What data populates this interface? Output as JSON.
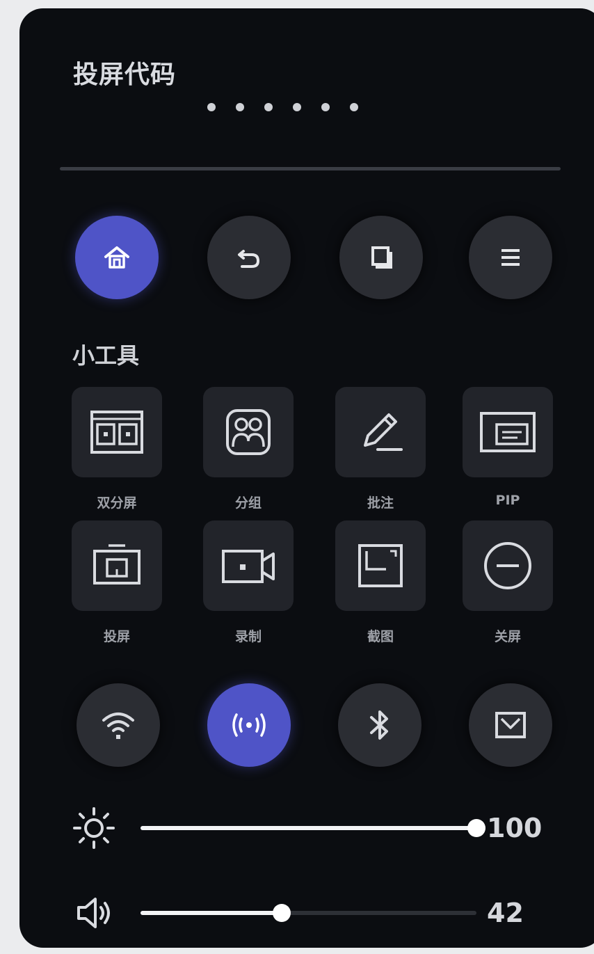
{
  "panel": {
    "title": "投屏代码",
    "code_dots": [
      "•",
      "•",
      "•",
      "•",
      "•",
      "•"
    ]
  },
  "nav_buttons": [
    {
      "icon": "home-icon",
      "active": true
    },
    {
      "icon": "back-icon",
      "active": false
    },
    {
      "icon": "recent-apps-icon",
      "active": false
    },
    {
      "icon": "menu-icon",
      "active": false
    }
  ],
  "tools": {
    "section_label": "小工具",
    "items": [
      {
        "label": "双分屏",
        "icon": "split-screen-icon"
      },
      {
        "label": "分组",
        "icon": "group-icon"
      },
      {
        "label": "批注",
        "icon": "annotate-icon"
      },
      {
        "label": "PIP",
        "icon": "pip-icon"
      },
      {
        "label": "投屏",
        "icon": "screen-cast-icon"
      },
      {
        "label": "录制",
        "icon": "record-icon"
      },
      {
        "label": "截图",
        "icon": "screenshot-icon"
      },
      {
        "label": "关屏",
        "icon": "screen-off-icon"
      }
    ]
  },
  "toggles": [
    {
      "icon": "wifi-icon",
      "active": false
    },
    {
      "icon": "hotspot-icon",
      "active": true
    },
    {
      "icon": "bluetooth-icon",
      "active": false
    },
    {
      "icon": "display-icon",
      "active": false
    }
  ],
  "brightness": {
    "value": "100",
    "level": 100
  },
  "volume": {
    "value": "42",
    "level": 42
  },
  "colors": {
    "panel_bg": "#0b0d11",
    "accent": "#4f54c7",
    "button_bg": "#2b2d33",
    "tile_bg": "#22242a"
  }
}
